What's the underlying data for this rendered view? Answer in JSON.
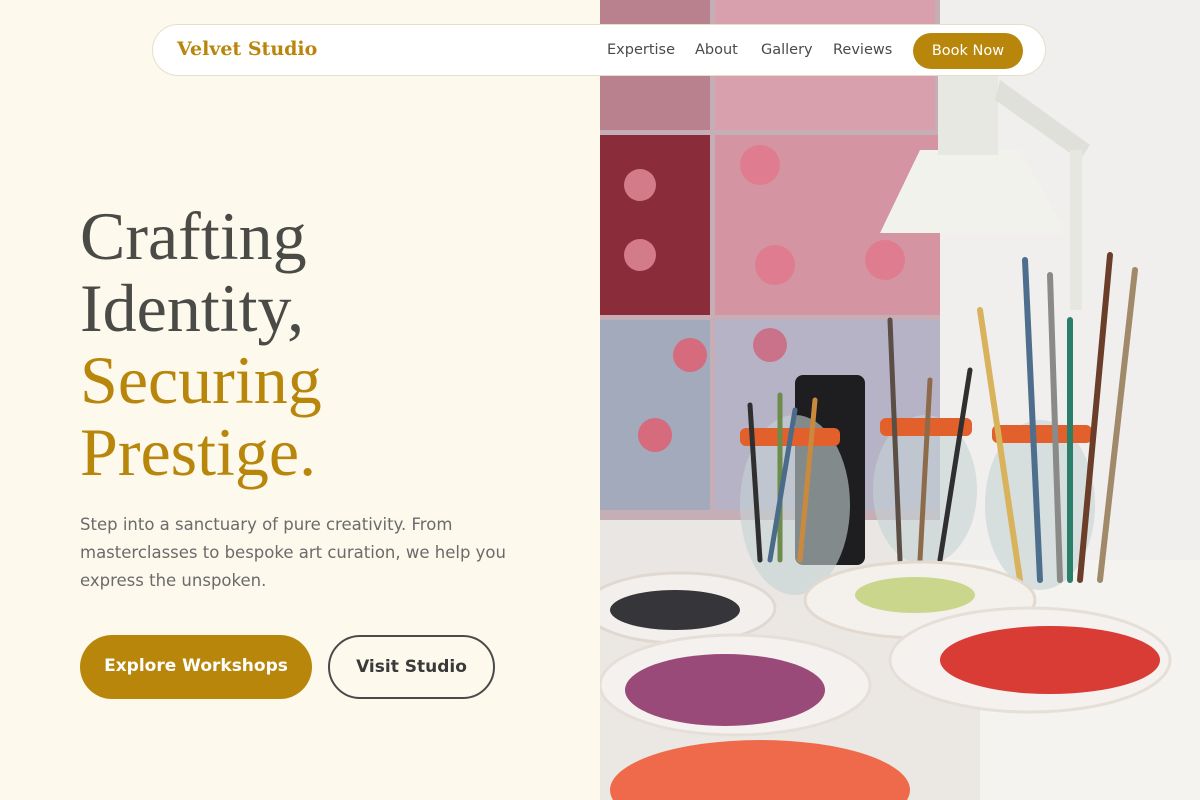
{
  "nav": {
    "brand": "Velvet Studio",
    "links": [
      "Expertise",
      "About",
      "Gallery",
      "Reviews"
    ],
    "cta": "Book Now"
  },
  "hero": {
    "headline_line1": "Crafting",
    "headline_line2": "Identity,",
    "headline_line3": "Securing",
    "headline_line4": "Prestige.",
    "lead": "Step into a sanctuary of pure creativity. From masterclasses to bespoke art curation, we help you express the unspoken.",
    "primary_button": "Explore Workshops",
    "secondary_button": "Visit Studio"
  },
  "photo": {
    "subject": "art studio table with paint brush jars and paint palettes"
  },
  "colors": {
    "accent": "#b8860b",
    "background": "#fdf9ec",
    "headline_dark": "#4a4a47",
    "body_text": "#6b6b6b"
  }
}
